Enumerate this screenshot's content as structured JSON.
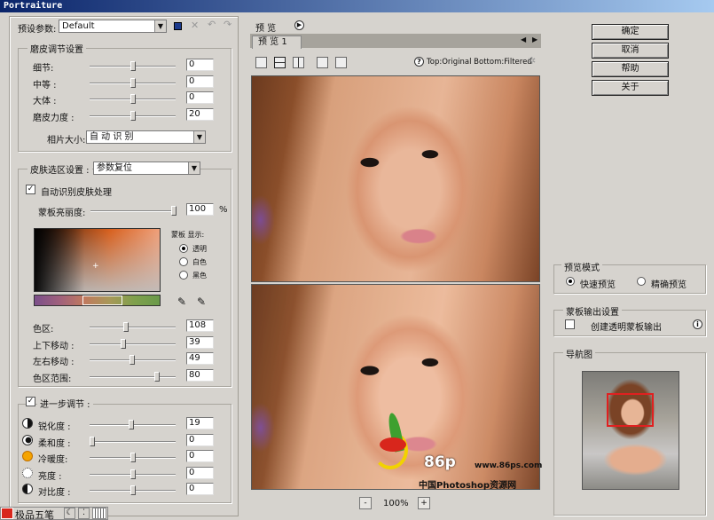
{
  "window": {
    "title": "Portraiture"
  },
  "preset": {
    "label": "预设参数:",
    "value": "Default"
  },
  "smoothing": {
    "title": "磨皮调节设置",
    "rows": [
      {
        "label": "细节:",
        "value": "0",
        "pos": 0.5
      },
      {
        "label": "中等 :",
        "value": "0",
        "pos": 0.5
      },
      {
        "label": "大体 :",
        "value": "0",
        "pos": 0.5
      },
      {
        "label": "磨皮力度 :",
        "value": "20",
        "pos": 0.5
      }
    ],
    "size_label": "相片大小:",
    "size_value": "自 动 识 别"
  },
  "skin": {
    "title": "皮肤选区设置 :",
    "dropdown": "参数复位",
    "auto_label": "自动识别皮肤处理",
    "opacity_label": "蒙板亮丽度:",
    "opacity_value": "100",
    "opacity_unit": "%",
    "mask_title": "蒙板 显示:",
    "mask_options": [
      "透明",
      "白色",
      "黑色"
    ],
    "rows": [
      {
        "label": "色区:",
        "value": "108",
        "pos": 0.42
      },
      {
        "label": "上下移动 :",
        "value": "39",
        "pos": 0.39
      },
      {
        "label": "左右移动 :",
        "value": "49",
        "pos": 0.49
      },
      {
        "label": "色区范围:",
        "value": "80",
        "pos": 0.8
      }
    ]
  },
  "enhance": {
    "title": "进一步调节 :",
    "rows": [
      {
        "label": "锐化度 :",
        "value": "19",
        "pos": 0.48
      },
      {
        "label": "柔和度 :",
        "value": "0",
        "pos": 0.0
      },
      {
        "label": "冷暖度:",
        "value": "0",
        "pos": 0.5
      },
      {
        "label": "亮度 :",
        "value": "0",
        "pos": 0.5
      },
      {
        "label": "对比度 :",
        "value": "0",
        "pos": 0.5
      }
    ]
  },
  "preview": {
    "label": "预 览",
    "tab": "预 览 1",
    "info": "Top:Original Bottom:Filtered",
    "zoom": "100%",
    "minus": "-",
    "plus": "+",
    "watermark_num": "86p",
    "watermark_url": "www.86ps.com",
    "watermark_cn": "中国Photoshop资源网"
  },
  "buttons": {
    "ok": "确定",
    "cancel": "取消",
    "help": "帮助",
    "about": "关于"
  },
  "preview_mode": {
    "title": "预览模式",
    "fast": "快速预览",
    "accurate": "精确预览"
  },
  "mask_output": {
    "title": "蒙板输出设置",
    "create": "创建透明蒙板输出"
  },
  "navigator": {
    "title": "导航图"
  },
  "ime": {
    "label": "极品五笔"
  }
}
